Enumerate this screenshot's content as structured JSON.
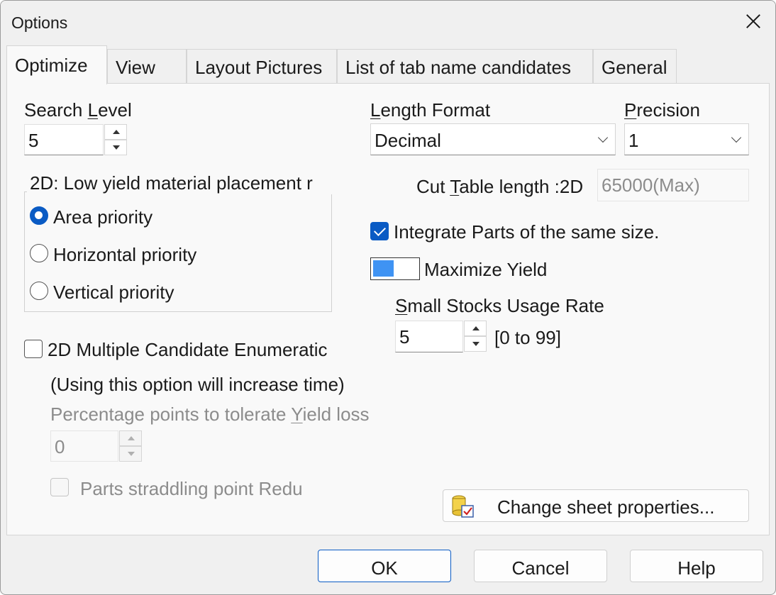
{
  "window": {
    "title": "Options"
  },
  "tabs": [
    {
      "label": "Optimize",
      "active": true
    },
    {
      "label": "View"
    },
    {
      "label": "Layout Pictures"
    },
    {
      "label": "List of tab name candidates"
    },
    {
      "label": "General"
    }
  ],
  "search_level": {
    "label_pre": "Search ",
    "label_u": "L",
    "label_post": "evel",
    "value": "5"
  },
  "length_format": {
    "label_u": "L",
    "label_post": "ength Format",
    "value": "Decimal"
  },
  "precision": {
    "label_u": "P",
    "label_post": "recision",
    "value": "1"
  },
  "cut_table": {
    "label_pre": "Cut ",
    "label_u": "T",
    "label_post": "able length :2D",
    "value": "65000(Max)"
  },
  "low_yield_group": {
    "title": "2D: Low yield material placement r",
    "options": [
      {
        "label": "Area priority",
        "selected": true
      },
      {
        "label": "Horizontal priority",
        "selected": false
      },
      {
        "label": "Vertical priority",
        "selected": false
      }
    ]
  },
  "integrate_parts": {
    "label": "Integrate Parts of the same size.",
    "checked": true
  },
  "maximize_yield": {
    "label": "Maximize Yield"
  },
  "small_stocks": {
    "label_u": "S",
    "label_post": "mall Stocks Usage Rate",
    "value": "5",
    "range": "[0 to 99]"
  },
  "multi_candidate": {
    "label": "2D Multiple Candidate Enumeratic",
    "checked": false,
    "note": "(Using this option will increase time)"
  },
  "tolerate": {
    "label_pre": "Percentage points to tolerate ",
    "label_u": "Y",
    "label_post": "ield loss",
    "value": "0"
  },
  "straddling": {
    "label": "Parts straddling point Redu",
    "checked": false
  },
  "sheet_button": {
    "label": "Change sheet properties..."
  },
  "buttons": {
    "ok": "OK",
    "cancel": "Cancel",
    "help": "Help"
  },
  "colors": {
    "accent": "#0a5bc4",
    "toggle_fill": "#3f93f3",
    "disabled_text": "#8c8c8c"
  }
}
